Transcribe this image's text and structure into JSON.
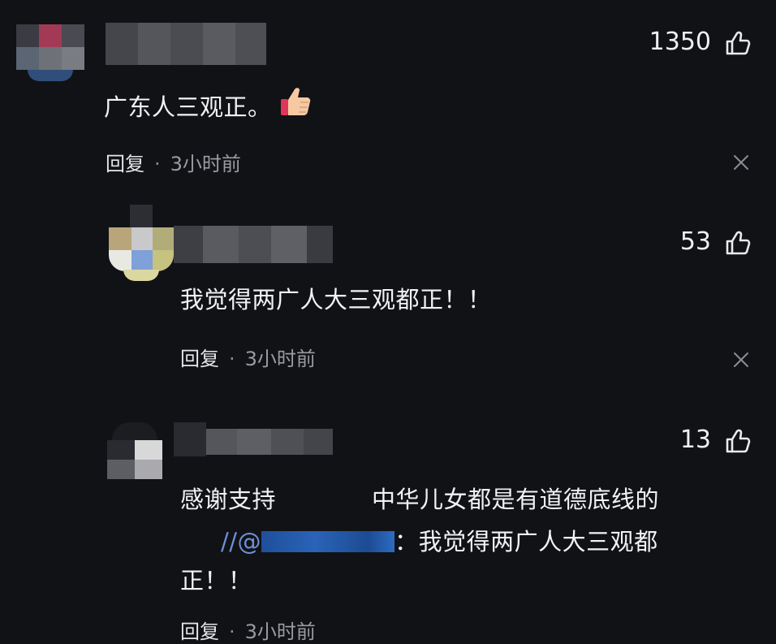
{
  "comments": [
    {
      "likes": "1350",
      "text": "广东人三观正。",
      "sticker_icon": "thumbs-up-emoji",
      "reply_label": "回复",
      "separator": "·",
      "time": "3小时前"
    },
    {
      "likes": "53",
      "text": "我觉得两广人大三观都正！！",
      "reply_label": "回复",
      "separator": "·",
      "time": "3小时前"
    },
    {
      "likes": "13",
      "text_line1": "感谢支持",
      "text_line1b": "中华儿女都是有道德底线的",
      "quote_prefix": "//@",
      "quote_sep": "：",
      "quote_text_line": "我觉得两广人大三观都",
      "quote_text_end": "正！！",
      "reply_label": "回复",
      "separator": "·",
      "time": "3小时前"
    }
  ],
  "icons": {
    "like": "thumbs-up-outline-icon",
    "dismiss": "close-icon"
  },
  "colors": {
    "background": "#111216",
    "text": "#f2f2f6",
    "muted": "#9a9aa3",
    "mention": "#6f8fd8"
  }
}
